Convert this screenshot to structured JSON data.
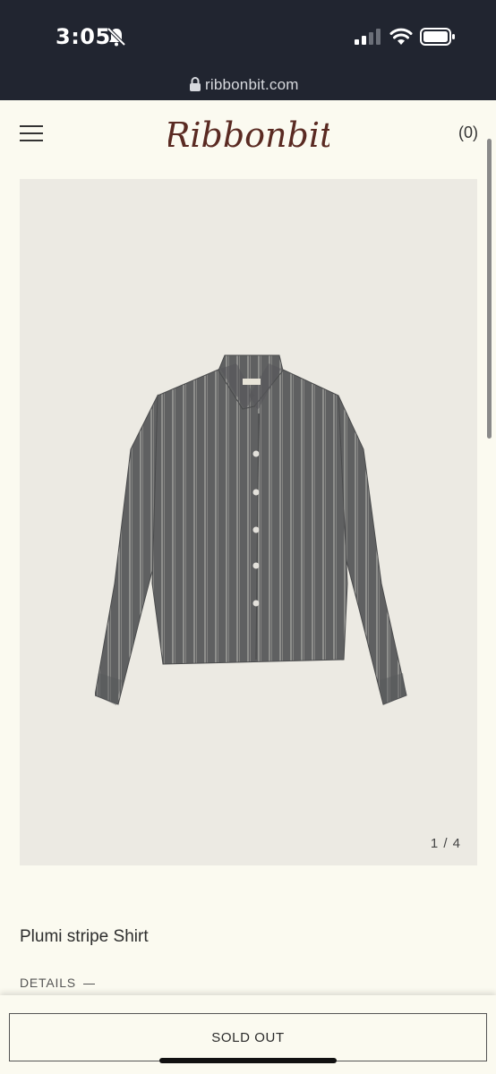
{
  "status_bar": {
    "time": "3:05"
  },
  "browser": {
    "url": "ribbonbit.com"
  },
  "header": {
    "logo_text": "Ribbonbit",
    "cart_label": "(0)"
  },
  "gallery": {
    "counter": "1 / 4"
  },
  "product": {
    "title": "Plumi stripe Shirt",
    "details_label": "DETAILS",
    "button_label": "SOLD OUT"
  },
  "icons": {
    "menu": "hamburger-menu-icon",
    "bell": "bell-slash-icon",
    "signal": "cellular-signal-icon",
    "wifi": "wifi-icon",
    "battery": "battery-icon",
    "lock": "lock-icon"
  },
  "colors": {
    "background": "#fbfaf0",
    "gallery_bg": "#eceae3",
    "logo": "#5a2a22",
    "status_bar": "#212530"
  }
}
